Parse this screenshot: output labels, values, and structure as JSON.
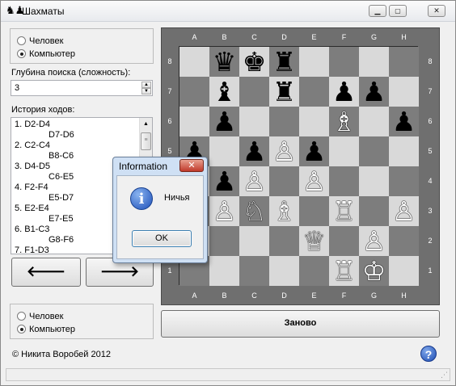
{
  "window": {
    "title": "Шахматы",
    "app_icon": "chess-pieces-icon",
    "controls": {
      "minimize": "▁",
      "maximize": "▢",
      "close": "✕"
    }
  },
  "top_player": {
    "options": [
      "Человек",
      "Компьютер"
    ],
    "selected": "Компьютер"
  },
  "search_depth": {
    "label": "Глубина поиска (сложность):",
    "value": "3"
  },
  "history": {
    "label": "История ходов:",
    "moves": [
      {
        "white": "1. D2-D4",
        "black": "D7-D6"
      },
      {
        "white": "2. C2-C4",
        "black": "B8-C6"
      },
      {
        "white": "3. D4-D5",
        "black": "C6-E5"
      },
      {
        "white": "4. F2-F4",
        "black": "E5-D7"
      },
      {
        "white": "5. E2-E4",
        "black": "E7-E5"
      },
      {
        "white": "6. B1-C3",
        "black": "G8-F6"
      },
      {
        "white": "7. F1-D3",
        "black": ""
      }
    ]
  },
  "nav": {
    "back": "🡐",
    "forward": "🡒"
  },
  "bottom_player": {
    "options": [
      "Человек",
      "Компьютер"
    ],
    "selected": "Компьютер"
  },
  "new_game_label": "Заново",
  "credit": "© Никита Воробей 2012",
  "help_icon": "?",
  "board": {
    "files": [
      "A",
      "B",
      "C",
      "D",
      "E",
      "F",
      "G",
      "H"
    ],
    "ranks": [
      "8",
      "7",
      "6",
      "5",
      "4",
      "3",
      "2",
      "1"
    ],
    "pieces": [
      "· ♛ ♚ ♜ · · · ·",
      "· ♝ · ♜ · ♟ ♟ ·",
      "· ♟ · · · ♗ · ♟",
      "♟ · ♟ ♙ ♟ · · ·",
      "· ♟ ♙ · ♙ · · ·",
      "· ♙ ♘ ♗ · ♖ · ♙",
      "· · · · ♕ · ♙ ·",
      "· · · · · ♖ ♔ ·"
    ]
  },
  "dialog": {
    "title": "Information",
    "close": "✕",
    "icon": "i",
    "message": "Ничья",
    "ok_label": "OK"
  }
}
